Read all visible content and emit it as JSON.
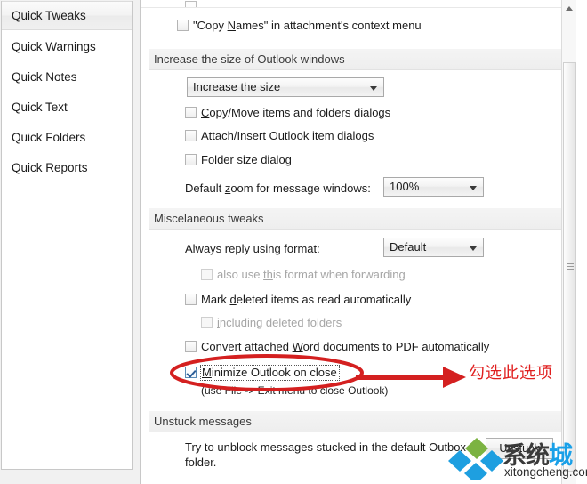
{
  "sidebar": {
    "items": [
      {
        "label": "Quick Tweaks",
        "selected": true
      },
      {
        "label": "Quick Warnings",
        "selected": false
      },
      {
        "label": "Quick Notes",
        "selected": false
      },
      {
        "label": "Quick Text",
        "selected": false
      },
      {
        "label": "Quick Folders",
        "selected": false
      },
      {
        "label": "Quick Reports",
        "selected": false
      }
    ]
  },
  "panel": {
    "copy_names_checkbox": {
      "prefix": "\"Copy ",
      "accel": "N",
      "suffix": "ames\" in attachment's context menu",
      "checked": false
    },
    "section_increase": {
      "title": "Increase the size of Outlook windows",
      "size_combo_value": "Increase the size",
      "checkboxes": [
        {
          "prefix": "",
          "accel": "C",
          "suffix": "opy/Move items and folders dialogs",
          "checked": false
        },
        {
          "prefix": "",
          "accel": "A",
          "suffix": "ttach/Insert Outlook item dialogs",
          "checked": false
        },
        {
          "prefix": "",
          "accel": "F",
          "suffix": "older size dialog",
          "checked": false
        }
      ],
      "zoom_label_prefix": "Default ",
      "zoom_label_accel": "z",
      "zoom_label_suffix": "oom for message windows:",
      "zoom_combo_value": "100%"
    },
    "section_misc": {
      "title": "Miscelaneous tweaks",
      "reply_label_prefix": "Always ",
      "reply_label_accel": "r",
      "reply_label_suffix": "eply using format:",
      "reply_combo_value": "Default",
      "forward_checkbox": {
        "prefix": "also use ",
        "accel": "th",
        "suffix": "is format when forwarding",
        "checked": false,
        "disabled": true
      },
      "mark_deleted_checkbox": {
        "prefix": "Mark ",
        "accel": "d",
        "suffix": "eleted items as read automatically",
        "checked": false
      },
      "including_deleted_checkbox": {
        "prefix": "",
        "accel": "i",
        "suffix": "ncluding deleted folders",
        "checked": false,
        "disabled": true
      },
      "convert_word_checkbox": {
        "prefix": "Convert attached ",
        "accel": "W",
        "suffix": "ord documents to PDF automatically",
        "checked": false
      },
      "minimize_checkbox": {
        "prefix": "",
        "accel": "M",
        "suffix": "inimize Outlook on close",
        "checked": true,
        "focused": true
      },
      "minimize_note": "(use File -> Exit menu to close Outlook)"
    },
    "section_unstuck": {
      "title": "Unstuck messages",
      "description_line1": "Try to unblock messages stucked in the default Outbox",
      "description_line2": "folder.",
      "button_label": "Unstuck"
    }
  },
  "annotation": {
    "text": "勾选此选项",
    "color": "#e02020"
  },
  "watermark": {
    "text_dark": "系统",
    "text_blue": "城",
    "url": "xitongcheng.com"
  }
}
